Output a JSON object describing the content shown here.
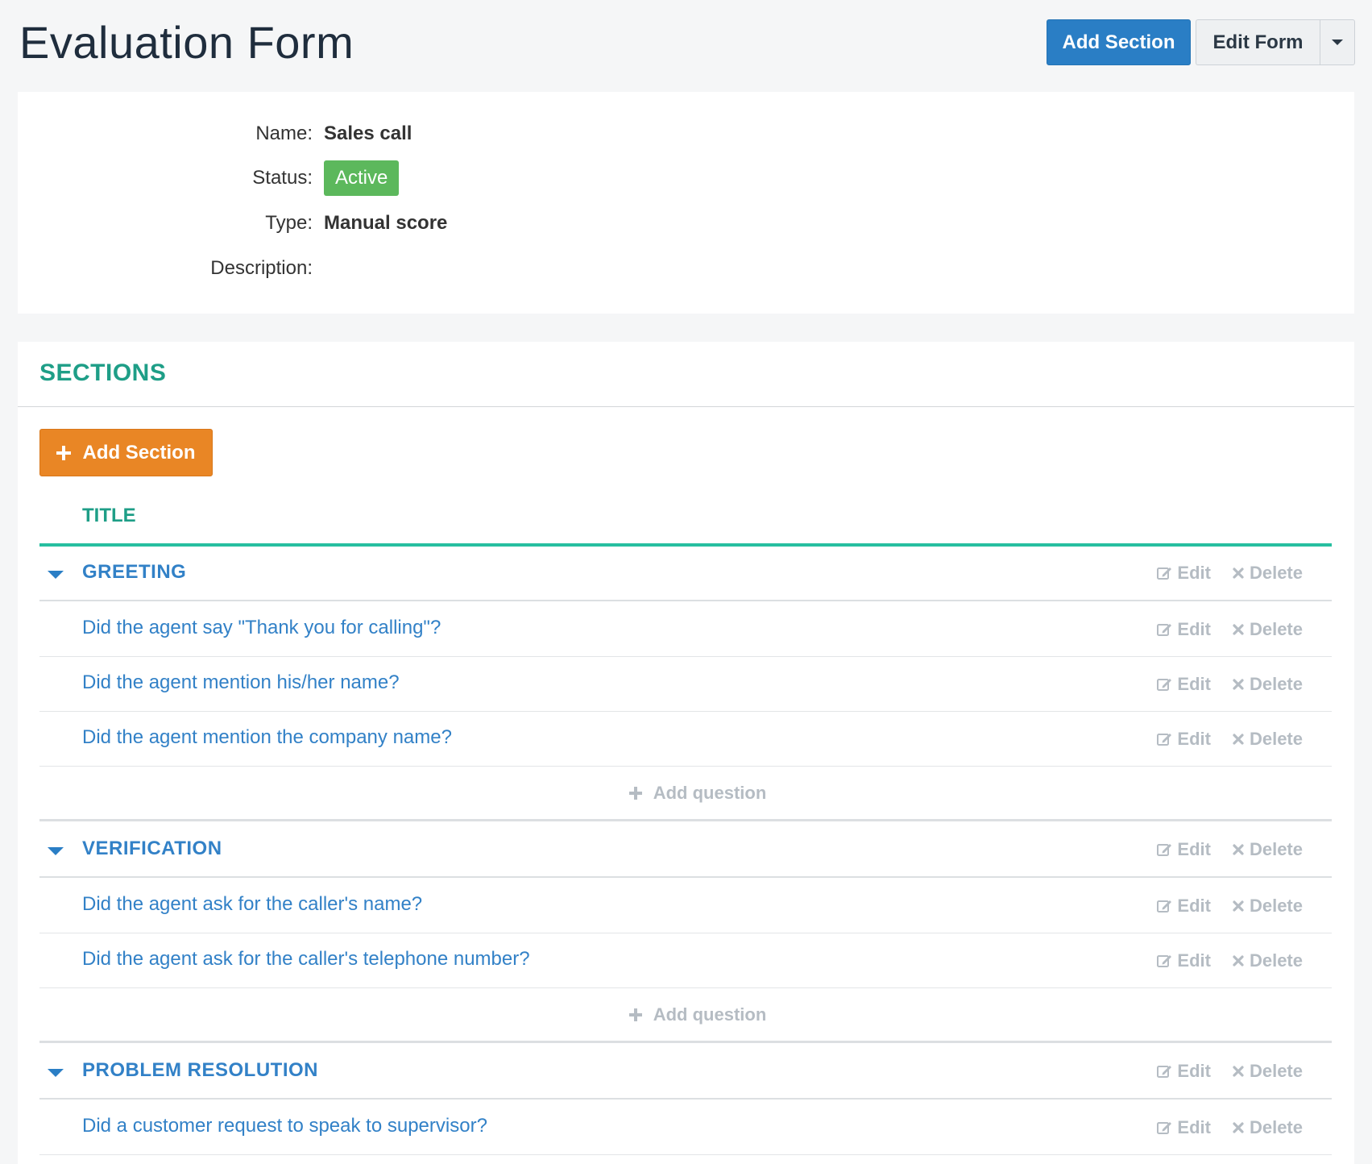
{
  "header": {
    "title": "Evaluation Form",
    "add_section_label": "Add Section",
    "edit_form_label": "Edit Form"
  },
  "info": {
    "name_label": "Name:",
    "name_value": "Sales call",
    "status_label": "Status:",
    "status_value": "Active",
    "type_label": "Type:",
    "type_value": "Manual score",
    "description_label": "Description:",
    "description_value": ""
  },
  "sections_panel": {
    "heading": "SECTIONS",
    "add_section_label": "Add Section",
    "column_title": "TITLE",
    "edit_label": "Edit",
    "delete_label": "Delete",
    "add_question_label": "Add question",
    "sections": [
      {
        "title": "GREETING",
        "questions": [
          "Did the agent say \"Thank you for calling\"?",
          "Did the agent mention his/her name?",
          "Did the agent mention the company name?"
        ]
      },
      {
        "title": "VERIFICATION",
        "questions": [
          "Did the agent ask for the caller's name?",
          "Did the agent ask for the caller's telephone number?"
        ]
      },
      {
        "title": "PROBLEM RESOLUTION",
        "questions": [
          "Did a customer request to speak to supervisor?"
        ]
      }
    ]
  },
  "colors": {
    "primary": "#2a7ec5",
    "accent_green": "#1e9e87",
    "orange": "#e98625",
    "status_active": "#5cb85c",
    "muted_action": "#b5bcc3"
  }
}
